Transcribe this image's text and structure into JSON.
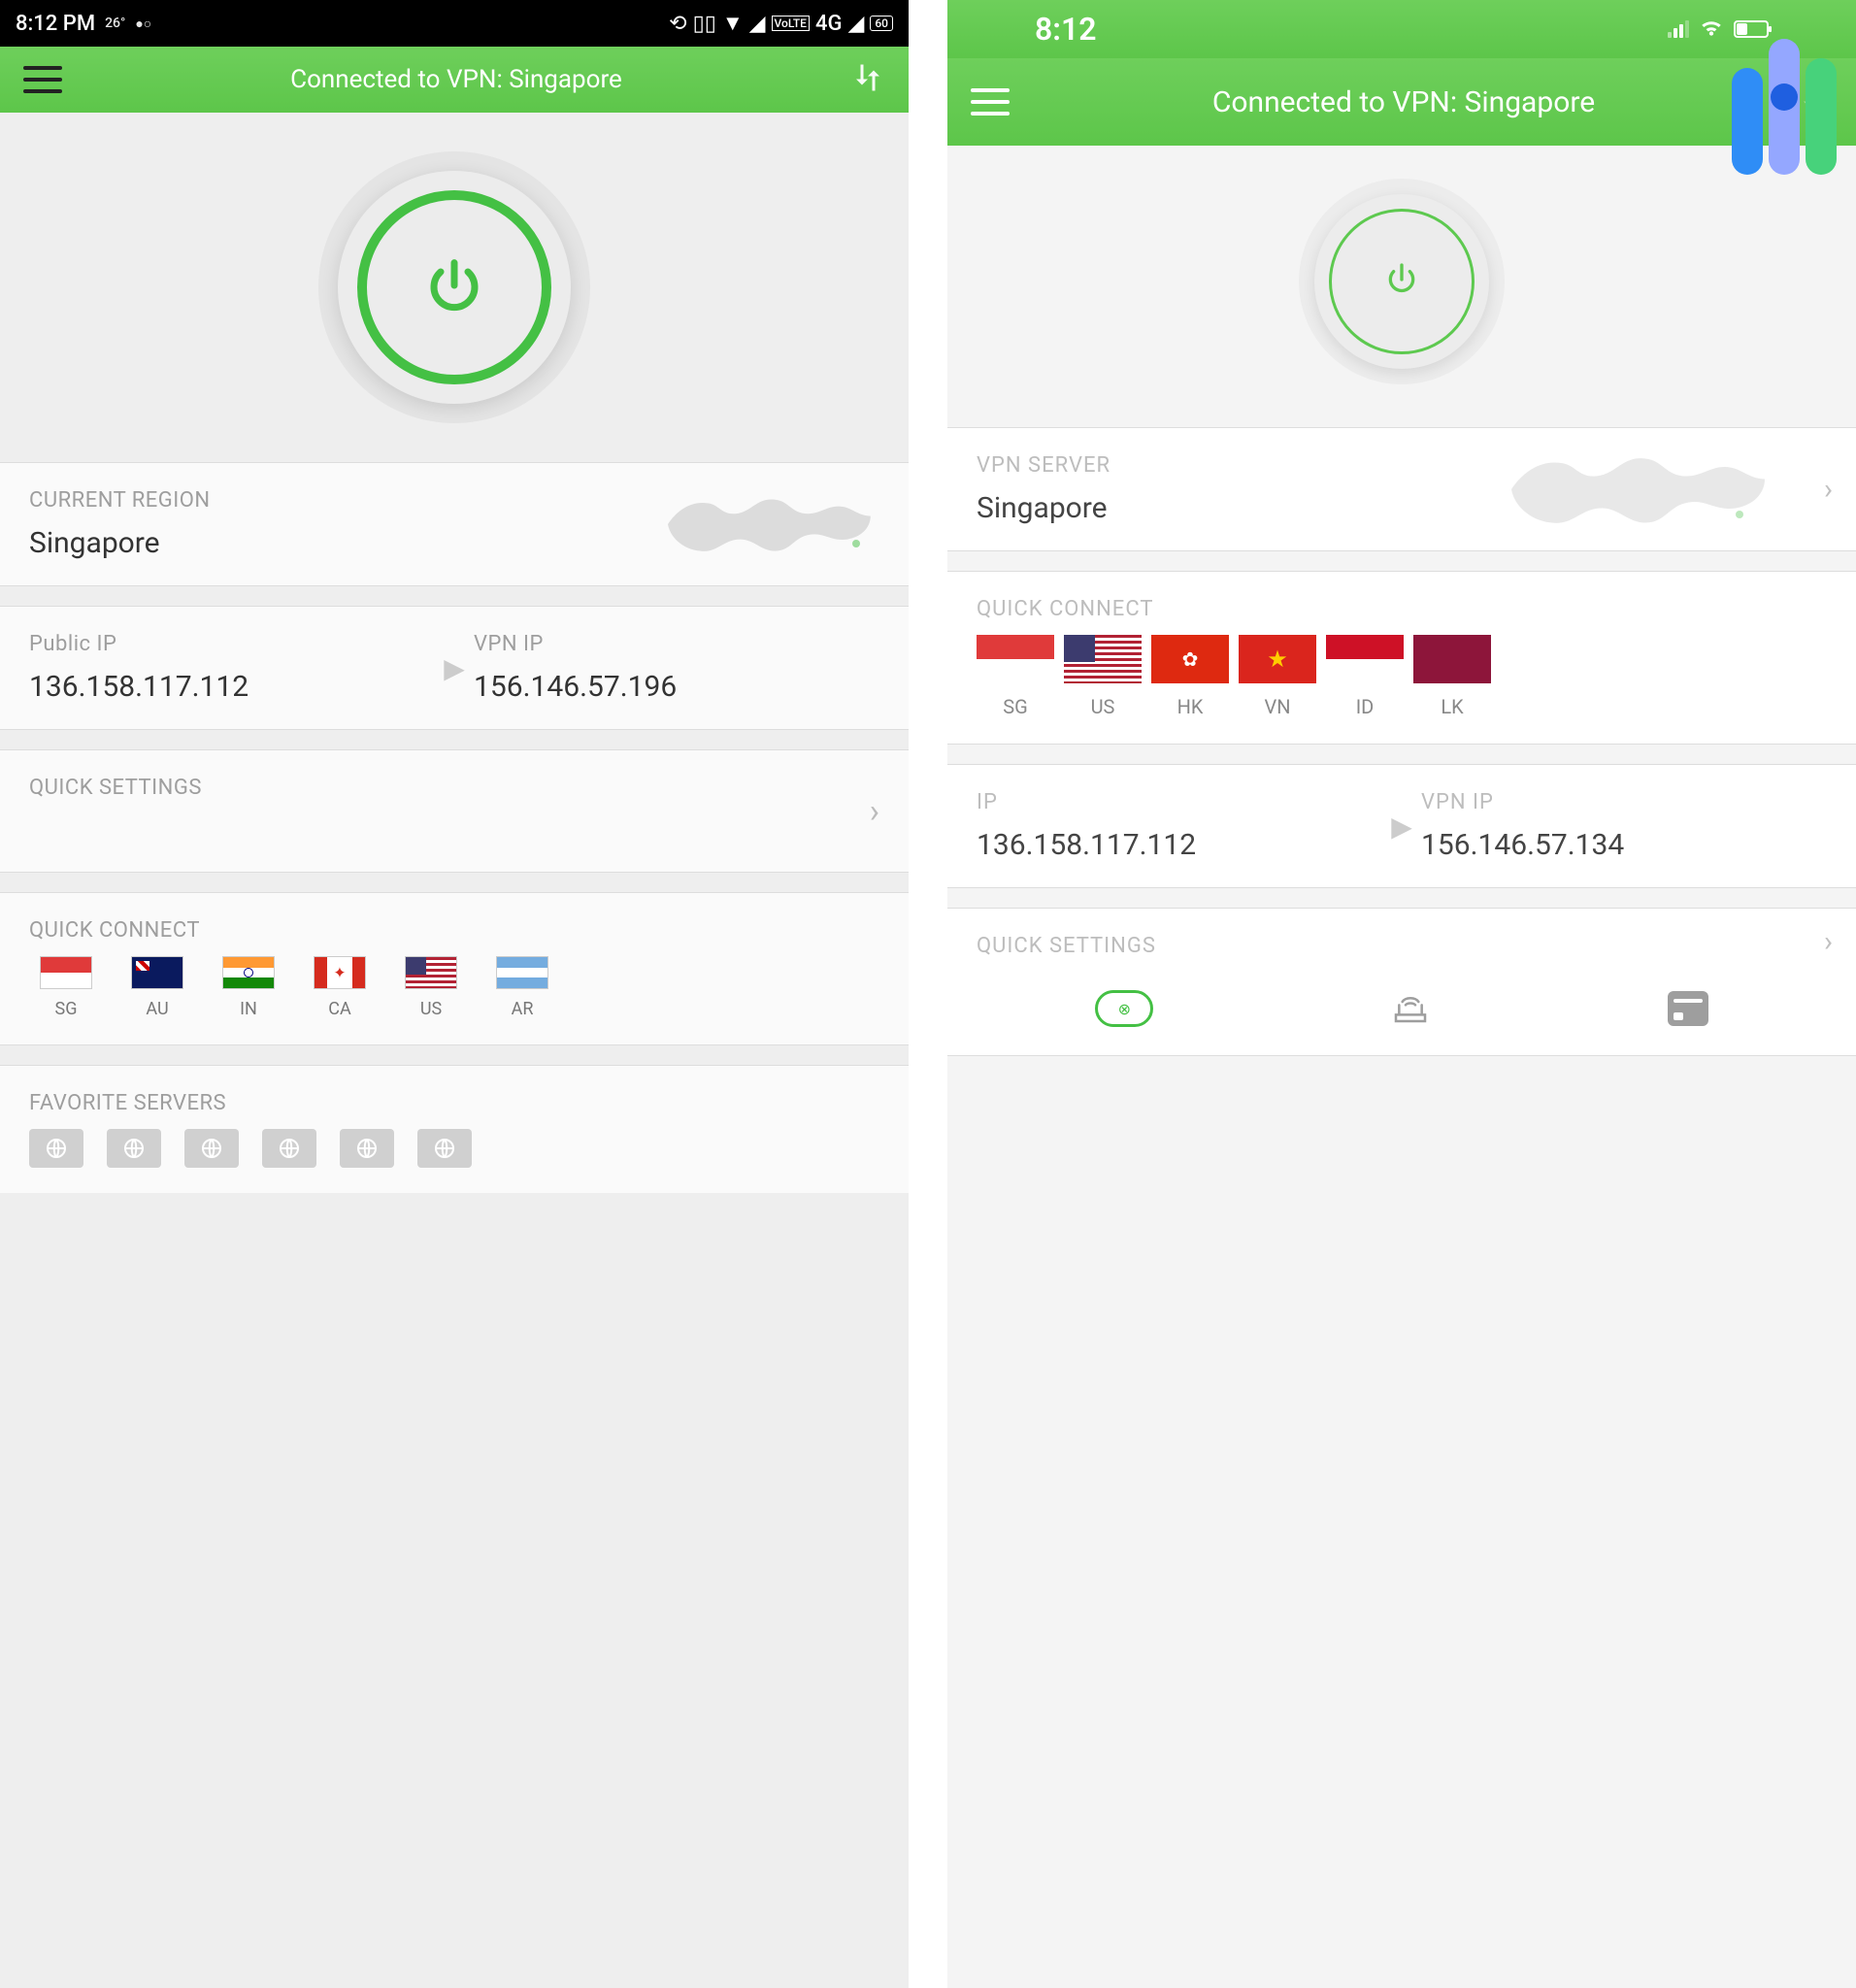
{
  "left": {
    "status": {
      "time": "8:12 PM",
      "temp": "26°",
      "indicators": "⟲  ▯▯  ▼  ⫽  VoLTE 4G  ⫽  ▭"
    },
    "header": {
      "title": "Connected to VPN: Singapore"
    },
    "region": {
      "label": "CURRENT REGION",
      "value": "Singapore"
    },
    "ip": {
      "public_label": "Public IP",
      "public_value": "136.158.117.112",
      "vpn_label": "VPN IP",
      "vpn_value": "156.146.57.196"
    },
    "quick_settings_label": "QUICK SETTINGS",
    "quick_connect_label": "QUICK CONNECT",
    "quick_connect": [
      {
        "code": "SG"
      },
      {
        "code": "AU"
      },
      {
        "code": "IN"
      },
      {
        "code": "CA"
      },
      {
        "code": "US"
      },
      {
        "code": "AR"
      }
    ],
    "favorite_label": "FAVORITE SERVERS"
  },
  "right": {
    "status": {
      "time": "8:12"
    },
    "header": {
      "title": "Connected to VPN: Singapore"
    },
    "server": {
      "label": "VPN SERVER",
      "value": "Singapore"
    },
    "quick_connect_label": "QUICK CONNECT",
    "quick_connect": [
      {
        "code": "SG"
      },
      {
        "code": "US"
      },
      {
        "code": "HK"
      },
      {
        "code": "VN"
      },
      {
        "code": "ID"
      },
      {
        "code": "LK"
      }
    ],
    "ip": {
      "public_label": "IP",
      "public_value": "136.158.117.112",
      "vpn_label": "VPN IP",
      "vpn_value": "156.146.57.134"
    },
    "quick_settings_label": "QUICK SETTINGS"
  }
}
